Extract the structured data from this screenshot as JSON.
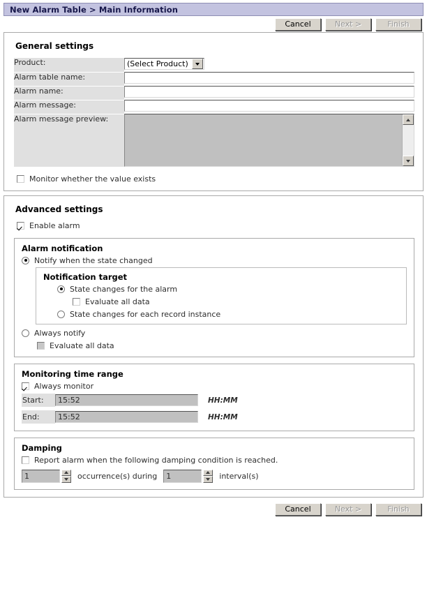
{
  "window": {
    "title": "New Alarm Table > Main Information"
  },
  "toolbar": {
    "cancel_label": "Cancel",
    "next_label": "Next >",
    "finish_label": "Finish"
  },
  "general": {
    "section_title": "General settings",
    "product_label": "Product:",
    "product_value": "(Select Product)",
    "alarm_table_name_label": "Alarm table name:",
    "alarm_table_name_value": "",
    "alarm_name_label": "Alarm name:",
    "alarm_name_value": "",
    "alarm_message_label": "Alarm message:",
    "alarm_message_value": "",
    "preview_label": "Alarm message preview:",
    "preview_value": "",
    "monitor_value_exists_label": "Monitor whether the value exists"
  },
  "advanced": {
    "section_title": "Advanced settings",
    "enable_alarm_label": "Enable alarm",
    "notification": {
      "title": "Alarm notification",
      "notify_state_changed_label": "Notify when the state changed",
      "target_title": "Notification target",
      "state_changes_alarm_label": "State changes for the alarm",
      "evaluate_all_data_label": "Evaluate all data",
      "state_changes_record_label": "State changes for each record instance",
      "always_notify_label": "Always notify",
      "always_evaluate_all_data_label": "Evaluate all data"
    },
    "time_range": {
      "title": "Monitoring time range",
      "always_monitor_label": "Always monitor",
      "start_label": "Start:",
      "start_value": "15:52",
      "start_hint": "HH:MM",
      "end_label": "End:",
      "end_value": "15:52",
      "end_hint": "HH:MM"
    },
    "damping": {
      "title": "Damping",
      "report_label": "Report alarm when the following damping condition is reached.",
      "occurrences_value": "1",
      "occurrences_label": "occurrence(s) during",
      "interval_value": "1",
      "interval_label": "interval(s)"
    }
  }
}
